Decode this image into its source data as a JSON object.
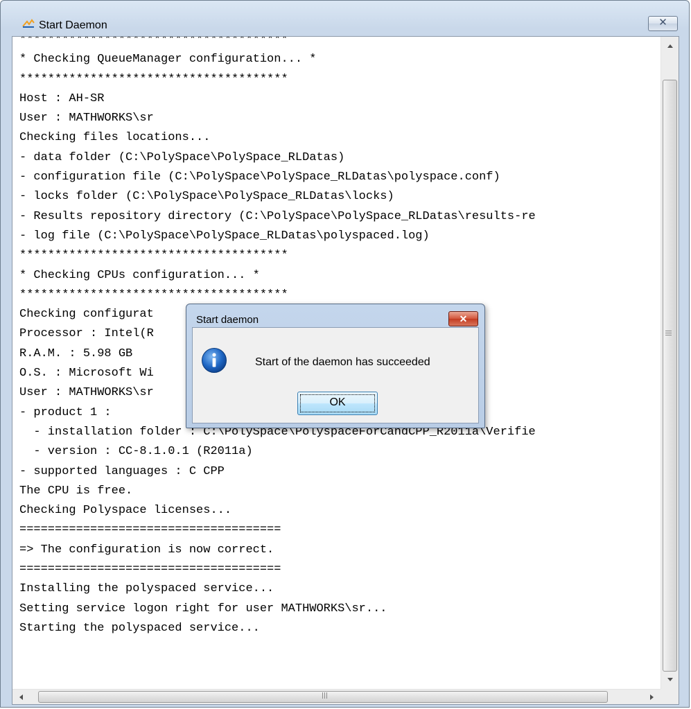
{
  "window": {
    "title": "Start Daemon",
    "close_glyph": "✕",
    "icon": "polyspace-app-icon"
  },
  "log": {
    "lines": [
      "**************************************",
      "* Checking QueueManager configuration... *",
      "**************************************",
      "Host : AH-SR",
      "User : MATHWORKS\\sr",
      "Checking files locations...",
      "- data folder (C:\\PolySpace\\PolySpace_RLDatas)",
      "- configuration file (C:\\PolySpace\\PolySpace_RLDatas\\polyspace.conf)",
      "- locks folder (C:\\PolySpace\\PolySpace_RLDatas\\locks)",
      "- Results repository directory (C:\\PolySpace\\PolySpace_RLDatas\\results-re",
      "- log file (C:\\PolySpace\\PolySpace_RLDatas\\polyspaced.log)",
      "**************************************",
      "* Checking CPUs configuration... *",
      "**************************************",
      "Checking configurat",
      "Processor : Intel(R                               2.40GHz",
      "R.A.M. : 5.98 GB",
      "O.S. : Microsoft Wi                                 k 2)",
      "User : MATHWORKS\\sr",
      "- product 1 :",
      "  - installation folder : C:\\PolySpace\\PolyspaceForCandCPP_R2011a\\Verifie",
      "  - version : CC-8.1.0.1 (R2011a)",
      "- supported languages : C CPP",
      "The CPU is free.",
      "Checking Polyspace licenses...",
      "=====================================",
      "=> The configuration is now correct.",
      "=====================================",
      "Installing the polyspaced service...",
      "Setting service logon right for user MATHWORKS\\sr...",
      "Starting the polyspaced service..."
    ]
  },
  "scrollbars": {
    "vertical": {
      "up_icon": "arrow-up-icon",
      "down_icon": "arrow-down-icon"
    },
    "horizontal": {
      "left_icon": "arrow-left-icon",
      "right_icon": "arrow-right-icon"
    }
  },
  "dialog": {
    "title": "Start daemon",
    "close_glyph": "✕",
    "icon": "information-icon",
    "message": "Start of the daemon has succeeded",
    "ok_label": "OK"
  },
  "colors": {
    "dialog_close": "#c94a2f",
    "info_icon": "#1f67c4",
    "ok_button_border": "#3c7fb1"
  }
}
